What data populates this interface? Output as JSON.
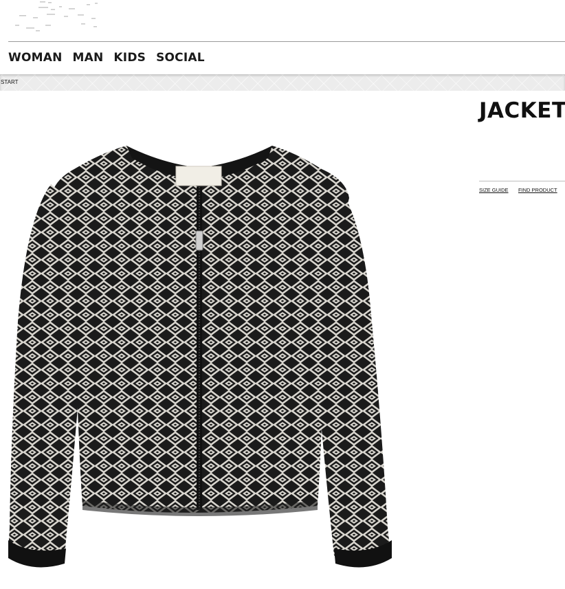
{
  "header": {
    "nav": [
      {
        "label": "WOMAN"
      },
      {
        "label": "MAN"
      },
      {
        "label": "KIDS"
      },
      {
        "label": "SOCIAL"
      }
    ]
  },
  "breadcrumb": {
    "label": "START"
  },
  "product": {
    "title": "JACKET",
    "links": {
      "size_guide": "SIZE GUIDE",
      "find_product": "FIND PRODUCT"
    },
    "image": {
      "subject": "black and white geometric pattern zip-front bomber jacket",
      "colors": {
        "dark": "#1b1b1b",
        "light": "#d9d6cf"
      }
    }
  }
}
